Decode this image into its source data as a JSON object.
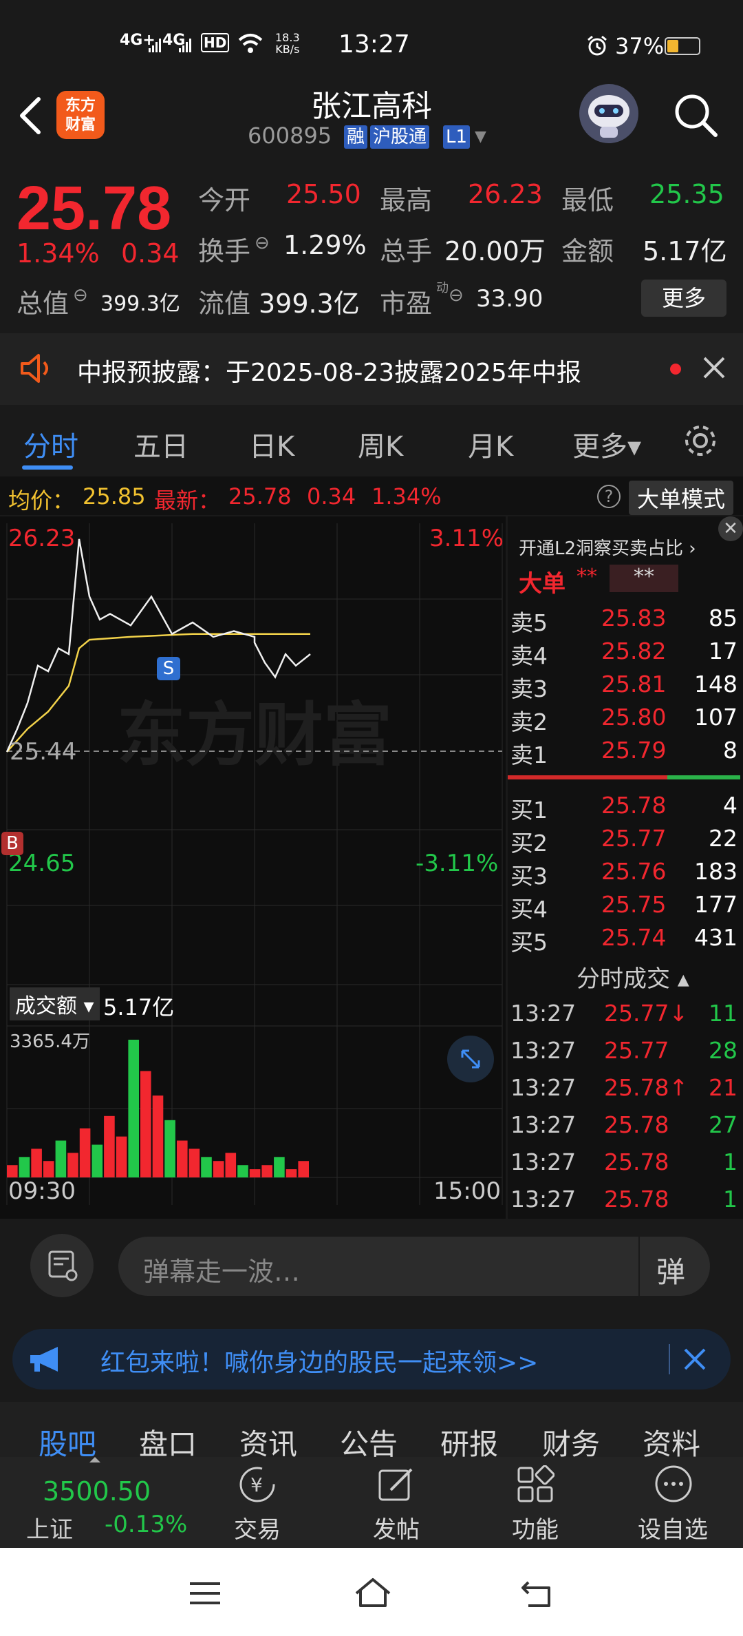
{
  "status_bar": {
    "signal1": "4G+",
    "signal2": "4G",
    "hd": "HD",
    "net_speed_value": "18.3",
    "net_speed_unit": "KB/s",
    "time": "13:27",
    "battery": "37%",
    "battery_level": 0.37
  },
  "header": {
    "logo_line1": "东方",
    "logo_line2": "财富",
    "stock_name": "张江高科",
    "stock_code": "600895",
    "tags": [
      "融",
      "沪股通",
      "L1"
    ]
  },
  "quote": {
    "price": "25.78",
    "change_pct": "1.34%",
    "change": "0.34",
    "open_label": "今开",
    "open": "25.50",
    "high_label": "最高",
    "high": "26.23",
    "low_label": "最低",
    "low": "25.35",
    "turnover_label": "换手",
    "turnover": "1.29%",
    "volume_label": "总手",
    "volume": "20.00万",
    "amount_label": "金额",
    "amount": "5.17亿",
    "mktcap_label": "总值",
    "mktcap": "399.3亿",
    "float_label": "流值",
    "float_cap": "399.3亿",
    "pe_label": "市盈",
    "pe_sup": "动",
    "pe": "33.90",
    "more_label": "更多"
  },
  "notice": {
    "text": "中报预披露：于2025-08-23披露2025年中报"
  },
  "tabs": [
    "分时",
    "五日",
    "日K",
    "周K",
    "月K",
    "更多▾"
  ],
  "infobar": {
    "avg_label": "均价：",
    "avg": "25.85",
    "latest_label": "最新：",
    "latest": "25.78",
    "latest_change": "0.34",
    "latest_pct": "1.34%",
    "mode_label": "大单模式"
  },
  "chart": {
    "y_max": "26.23",
    "y_max_pct": "3.11%",
    "y_mid": "25.44",
    "y_min": "24.65",
    "y_min_pct": "-3.11%",
    "watermark": "东方财富",
    "marker_s": "S",
    "marker_b": "B",
    "vol_label": "成交额",
    "vol_total": "5.17亿",
    "vol_max": "3365.4万",
    "time_start": "09:30",
    "time_end": "15:00"
  },
  "chart_data": {
    "type": "line",
    "series": [
      {
        "name": "",
        "x": [
          "09:30",
          "09:35",
          "09:40",
          "09:45",
          "09:50",
          "09:55",
          "10:00",
          "10:05",
          "10:10",
          "10:15",
          "10:20",
          "10:30",
          "10:40",
          "10:50",
          "11:00",
          "11:10",
          "11:20",
          "11:30",
          "13:00",
          "13:05",
          "13:10",
          "13:15",
          "13:20",
          "13:27"
        ],
        "values": [
          25.44,
          25.52,
          25.61,
          25.74,
          25.72,
          25.8,
          25.78,
          26.18,
          25.98,
          25.9,
          25.92,
          25.88,
          25.98,
          25.85,
          25.89,
          25.84,
          25.86,
          25.84,
          25.82,
          25.75,
          25.7,
          25.78,
          25.74,
          25.78
        ]
      },
      {
        "name": "均价",
        "x": [
          "09:30",
          "09:40",
          "09:50",
          "10:00",
          "10:05",
          "10:10",
          "10:30",
          "11:00",
          "11:30",
          "13:00",
          "13:27"
        ],
        "values": [
          25.44,
          25.52,
          25.58,
          25.67,
          25.8,
          25.83,
          25.84,
          25.85,
          25.85,
          25.85,
          25.85
        ]
      }
    ],
    "volume": [
      300,
      500,
      700,
      400,
      900,
      600,
      1200,
      800,
      1500,
      1000,
      3365,
      2600,
      2000,
      1400,
      900,
      700,
      500,
      400,
      600,
      300,
      200,
      300,
      500,
      200,
      400
    ],
    "ylim": [
      24.65,
      26.23
    ]
  },
  "orderbook": {
    "header": "开通L2洞察买卖占比 ›",
    "big_order": "大单",
    "big_stars1": "**",
    "big_stars2": "**",
    "asks": [
      {
        "label": "卖5",
        "price": "25.83",
        "vol": "85"
      },
      {
        "label": "卖4",
        "price": "25.82",
        "vol": "17"
      },
      {
        "label": "卖3",
        "price": "25.81",
        "vol": "148"
      },
      {
        "label": "卖2",
        "price": "25.80",
        "vol": "107"
      },
      {
        "label": "卖1",
        "price": "25.79",
        "vol": "8"
      }
    ],
    "bids": [
      {
        "label": "买1",
        "price": "25.78",
        "vol": "4"
      },
      {
        "label": "买2",
        "price": "25.77",
        "vol": "22"
      },
      {
        "label": "买3",
        "price": "25.76",
        "vol": "183"
      },
      {
        "label": "买4",
        "price": "25.75",
        "vol": "177"
      },
      {
        "label": "买5",
        "price": "25.74",
        "vol": "431"
      }
    ],
    "ticks_header": "分时成交 ▴",
    "ticks": [
      {
        "time": "13:27",
        "price": "25.77↓",
        "vol": "11",
        "vol_color": "#22c74a"
      },
      {
        "time": "13:27",
        "price": "25.77",
        "vol": "28",
        "vol_color": "#22c74a"
      },
      {
        "time": "13:27",
        "price": "25.78↑",
        "vol": "21",
        "vol_color": "#f2272f"
      },
      {
        "time": "13:27",
        "price": "25.78",
        "vol": "27",
        "vol_color": "#22c74a"
      },
      {
        "time": "13:27",
        "price": "25.78",
        "vol": "1",
        "vol_color": "#22c74a"
      },
      {
        "time": "13:27",
        "price": "25.78",
        "vol": "1",
        "vol_color": "#22c74a"
      }
    ]
  },
  "comment": {
    "placeholder": "弹幕走一波…",
    "danmu_btn": "弹"
  },
  "banner": {
    "text": "红包来啦！喊你身边的股民一起来领>>"
  },
  "subtabs": [
    "股吧",
    "盘口",
    "资讯",
    "公告",
    "研报",
    "财务",
    "资料"
  ],
  "toolbar": {
    "index_value": "3500.50",
    "index_name": "上证",
    "index_change": "-0.13%",
    "items": [
      "交易",
      "发帖",
      "功能",
      "设自选"
    ]
  },
  "colors": {
    "up": "#f2272f",
    "down": "#22c74a",
    "accent": "#3f8ef5",
    "brand": "#f25a1b"
  }
}
